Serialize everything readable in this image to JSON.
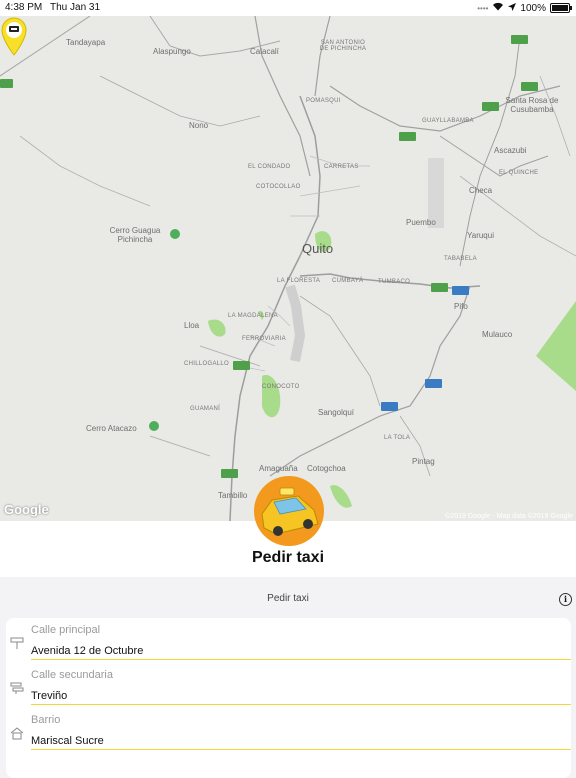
{
  "status_bar": {
    "time": "4:38 PM",
    "date": "Thu Jan 31",
    "battery": "100%"
  },
  "map": {
    "logo": "Google",
    "attribution": "©2019 Google - Map data ©2019 Google",
    "labels": {
      "tandayapa": "Tandayapa",
      "alaspungo": "Alaspungo",
      "calacali": "Calacalí",
      "san_antonio": "SAN ANTONIO DE PICHINCHA",
      "pomasqui": "POMASQUI",
      "guayllabamba": "GUAYLLABAMBA",
      "santa_rosa": "Santa Rosa de Cusubamba",
      "nono": "Nono",
      "el_condado": "EL CONDADO",
      "carretas": "CARRETAS",
      "cotocollao": "COTOCOLLAO",
      "ascazubi": "Ascazubi",
      "el_quinche": "EL QUINCHE",
      "checa": "Checa",
      "puembo": "Puembo",
      "yaruqui": "Yaruqui",
      "cerro_guagua": "Cerro Guagua Pichincha",
      "quito": "Quito",
      "la_floresta": "LA FLORESTA",
      "cumbaya": "CUMBAYÁ",
      "tumbaco": "TUMBACO",
      "tababela": "TABABELA",
      "pifo": "Pifo",
      "lloa": "Lloa",
      "la_magdalena": "LA MAGDALENA",
      "ferroviaria": "FERROVIARIA",
      "chillogallo": "CHILLOGALLO",
      "conocoto": "CONOCOTO",
      "mulauco": "Mulauco",
      "guaman": "GUAMANÍ",
      "sangolqui": "Sangolquí",
      "cerro_atacazo": "Cerro Atacazo",
      "la_tola": "LA TOLA",
      "pintag": "Pintag",
      "amaguana": "Amaguaña",
      "cotogchoa": "Cotogchoa",
      "tambillo": "Tambillo"
    },
    "route_shields": [
      "28B",
      "28",
      "E35",
      "28B",
      "28A",
      "28C",
      "E35",
      "E35",
      "28A"
    ]
  },
  "title": "Pedir taxi",
  "section_header": "Pedir taxi",
  "form": {
    "main_street": {
      "label": "Calle principal",
      "value": "Avenida 12 de Octubre"
    },
    "secondary_street": {
      "label": "Calle secundaria",
      "value": "Treviño"
    },
    "neighborhood": {
      "label": "Barrio",
      "value": "Mariscal Sucre"
    }
  }
}
